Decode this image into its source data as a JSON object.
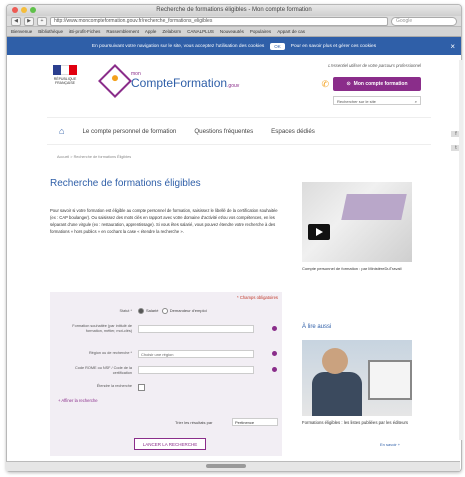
{
  "window": {
    "title": "Recherche de formations éligibles - Mon compte formation",
    "url": "http://www.moncompteformation.gouv.fr/recherche_formations_eligibles",
    "search_placeholder": "Google",
    "traffic_colors": [
      "#ee5b54",
      "#f5bd3b",
      "#5fc14a"
    ]
  },
  "bookmarks": [
    "Bienvenue",
    "Bibliothèque",
    "iBi-profit-Fiches",
    "Rassemblement",
    "Apple",
    "Zelabsrm",
    "CANALPLUS",
    "Nouveautés",
    "Populaires",
    "Appart de cas"
  ],
  "cookie": {
    "text": "En poursuivant votre navigation sur le site, vous acceptez l'utilisation des cookies",
    "ok": "OK",
    "more": "Pour en savoir plus et gérer ces cookies",
    "close": "×"
  },
  "header": {
    "rf_text": "RÉPUBLIQUE FRANÇAISE",
    "logo_small": "mon",
    "logo_big": "CompteFormation",
    "logo_suffix": ".gouv",
    "tagline": "L'essentiel utiliser de votre parcours professionnel",
    "button": "Mon compte formation",
    "search_placeholder": "Rechercher sur le site",
    "brand_color": "#8a2d8a",
    "accent_color": "#2f5fa8"
  },
  "nav": {
    "items": [
      "Le compte personnel de formation",
      "Questions fréquentes",
      "Espaces dédiés"
    ]
  },
  "side_tabs": [
    "f",
    "t"
  ],
  "breadcrumb": "Accueil > Recherche de formations Éligibles",
  "main": {
    "title": "Recherche de formations éligibles",
    "intro": "Pour savoir si votre formation est éligible au compte personnel de formation, saisissez le libellé de la certification souhaitée (ex : CAP boulanger). Ou saisissez des mots clés en rapport avec votre domaine d'activité et/ou vos compétences, en les séparant d'une virgule (ex : restauration, apprentissage). Si vous êtes salarié, vous pouvez étendre votre recherche à des formations « hors publics » en cochant la case « étendre la recherche »."
  },
  "form": {
    "required": "* Champs obligatoires",
    "statut_label": "Statut *",
    "radio_salarie": "Salarié",
    "radio_demandeur": "Demandeur d'emploi",
    "formation_label": "Formation souhaitée (par intitulé de formation, métier, mot-clés)",
    "region_label": "Région ou de recherche *",
    "region_value": "Choisir une région",
    "code_label": "Code ROME ou NSF / Code de la certification",
    "etendre_label": "Étendre la recherche",
    "affiner": "+ Affiner la recherche",
    "sort_label": "Trier les résultats par",
    "sort_value": "Pertinence",
    "submit": "LANCER LA RECHERCHE"
  },
  "sidebar": {
    "video_caption": "Compte personnel de formation : par MinistèreDuTravail",
    "section_title": "À lire aussi",
    "article_caption": "Formations éligibles : les listes publiées par les éditeurs",
    "more": "En savoir +"
  }
}
